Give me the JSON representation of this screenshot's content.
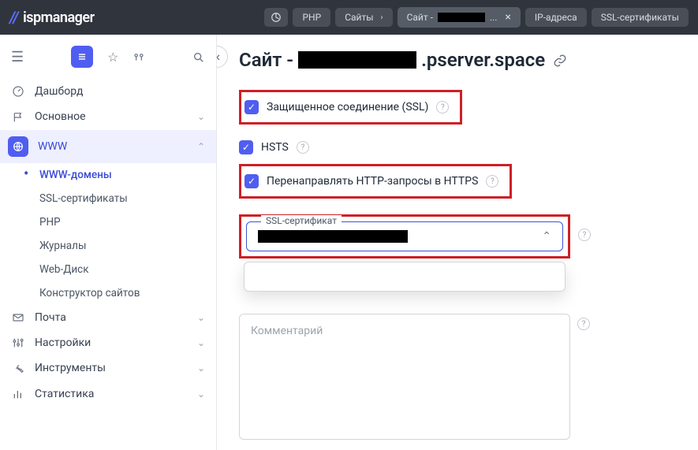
{
  "brand": "ispmanager",
  "tabs": {
    "php": "PHP",
    "sites": "Сайты",
    "current_prefix": "Сайт -",
    "current_suffix": "...",
    "ip": "IP-адреса",
    "ssl": "SSL-сертификаты"
  },
  "sidebar": {
    "dashboard": "Дашборд",
    "main": "Основное",
    "www": "WWW",
    "www_children": {
      "domains": "WWW-домены",
      "ssl": "SSL-сертификаты",
      "php": "PHP",
      "logs": "Журналы",
      "webdisk": "Web-Диск",
      "builder": "Конструктор сайтов"
    },
    "mail": "Почта",
    "settings": "Настройки",
    "tools": "Инструменты",
    "stats": "Статистика"
  },
  "page": {
    "title_prefix": "Сайт -",
    "title_suffix": ".pserver.space",
    "ssl_label": "Защищенное соединение (SSL)",
    "hsts_label": "HSTS",
    "redirect_label": "Перенаправлять HTTP-запросы в HTTPS",
    "cert_legend": "SSL-сертификат",
    "comment_placeholder": "Комментарий"
  }
}
